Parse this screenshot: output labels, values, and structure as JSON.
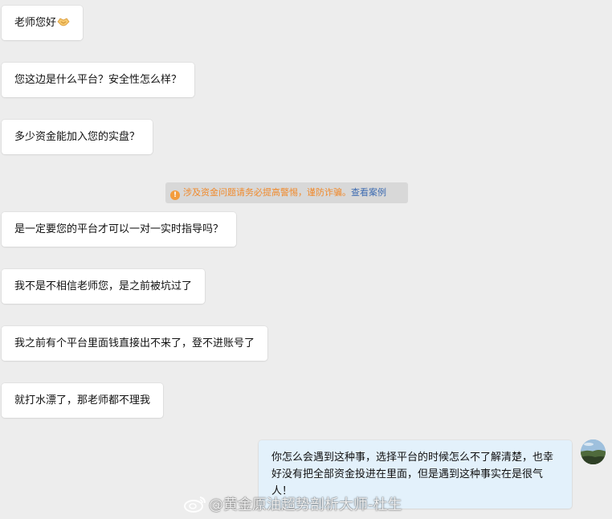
{
  "messages": [
    {
      "text": "老师您好",
      "icon": "handshake-emoji"
    },
    {
      "text": "您这边是什么平台？安全性怎么样？"
    },
    {
      "text": "多少资金能加入您的实盘？"
    },
    {
      "text": "是一定要您的平台才可以一对一实时指导吗？"
    },
    {
      "text": "我不是不相信老师您，是之前被坑过了"
    },
    {
      "text": "我之前有个平台里面钱直接出不来了，登不进账号了"
    },
    {
      "text": "就打水漂了，那老师都不理我"
    }
  ],
  "system_notice": {
    "icon": "info-icon",
    "text": "涉及资金问题请务必提高警惕，谨防诈骗。",
    "link": "查看案例"
  },
  "reply": {
    "text": "你怎么会遇到这种事，选择平台的时候怎么不了解清楚，也幸好没有把全部资金投进在里面，但是遇到这种事实在是很气人！"
  },
  "watermark": {
    "icon": "weibo-icon",
    "text": "@黄金原油超势剖析大师-杜生"
  },
  "colors": {
    "background": "#ededed",
    "incoming_bubble": "#ffffff",
    "outgoing_bubble": "#e3f1fb",
    "notice_text": "#f08a2c",
    "notice_link": "#3d6bb1"
  }
}
